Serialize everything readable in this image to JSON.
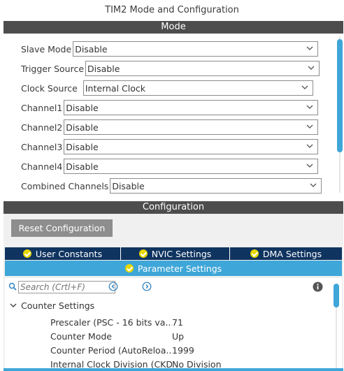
{
  "window": {
    "title": "TIM2 Mode and Configuration"
  },
  "mode": {
    "header": "Mode",
    "fields": [
      {
        "label": "Slave Mode",
        "value": "Disable"
      },
      {
        "label": "Trigger Source",
        "value": "Disable"
      },
      {
        "label": "Clock Source",
        "value": "Internal Clock"
      },
      {
        "label": "Channel1",
        "value": "Disable"
      },
      {
        "label": "Channel2",
        "value": "Disable"
      },
      {
        "label": "Channel3",
        "value": "Disable"
      },
      {
        "label": "Channel4",
        "value": "Disable"
      },
      {
        "label": "Combined Channels",
        "value": "Disable"
      }
    ]
  },
  "configuration": {
    "header": "Configuration",
    "reset_label": "Reset Configuration",
    "tabs": [
      {
        "label": "User Constants"
      },
      {
        "label": "NVIC Settings"
      },
      {
        "label": "DMA Settings"
      }
    ],
    "active_tab": {
      "label": "Parameter Settings"
    },
    "search": {
      "placeholder": "Search (Crtl+F)"
    },
    "group": {
      "label": "Counter Settings",
      "params": [
        {
          "name": "Prescaler (PSC - 16 bits va...",
          "value": "71"
        },
        {
          "name": "Counter Mode",
          "value": "Up"
        },
        {
          "name": "Counter Period (AutoReloa...",
          "value": "1999"
        },
        {
          "name": "Internal Clock Division (CKD)",
          "value": "No Division"
        }
      ]
    }
  },
  "colors": {
    "section_bar": "#4d4d4d",
    "tab_dark": "#0f3460",
    "tab_active": "#3ea6d8",
    "check": "#e8d800",
    "reset_button": "#8e8e8e"
  }
}
